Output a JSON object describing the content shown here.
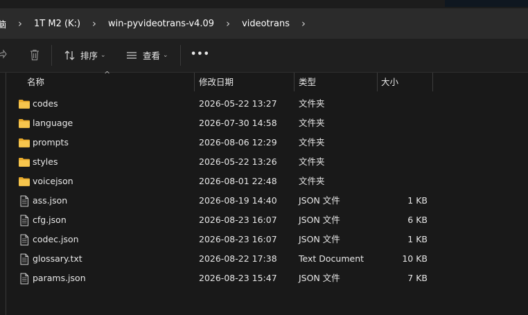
{
  "breadcrumbs": [
    {
      "label": "脑"
    },
    {
      "label": "1T M2 (K:)"
    },
    {
      "label": "win-pyvideotrans-v4.09"
    },
    {
      "label": "videotrans"
    }
  ],
  "toolbar": {
    "sort_label": "排序",
    "view_label": "查看",
    "more_label": "•••"
  },
  "columns": {
    "name": "名称",
    "date": "修改日期",
    "type": "类型",
    "size": "大小"
  },
  "files": [
    {
      "icon": "folder-icon",
      "name": "codes",
      "date": "2026-05-22 13:27",
      "type": "文件夹",
      "size": ""
    },
    {
      "icon": "folder-icon",
      "name": "language",
      "date": "2026-07-30 14:58",
      "type": "文件夹",
      "size": ""
    },
    {
      "icon": "folder-icon",
      "name": "prompts",
      "date": "2026-08-06 12:29",
      "type": "文件夹",
      "size": ""
    },
    {
      "icon": "folder-icon",
      "name": "styles",
      "date": "2026-05-22 13:26",
      "type": "文件夹",
      "size": ""
    },
    {
      "icon": "folder-icon",
      "name": "voicejson",
      "date": "2026-08-01 22:48",
      "type": "文件夹",
      "size": ""
    },
    {
      "icon": "file-icon",
      "name": "ass.json",
      "date": "2026-08-19 14:40",
      "type": "JSON 文件",
      "size": "1 KB"
    },
    {
      "icon": "file-icon",
      "name": "cfg.json",
      "date": "2026-08-23 16:07",
      "type": "JSON 文件",
      "size": "6 KB"
    },
    {
      "icon": "file-icon",
      "name": "codec.json",
      "date": "2026-08-23 16:07",
      "type": "JSON 文件",
      "size": "1 KB"
    },
    {
      "icon": "file-icon",
      "name": "glossary.txt",
      "date": "2026-08-22 17:38",
      "type": "Text Document",
      "size": "10 KB"
    },
    {
      "icon": "file-icon",
      "name": "params.json",
      "date": "2026-08-23 15:47",
      "type": "JSON 文件",
      "size": "7 KB"
    }
  ],
  "colors": {
    "background": "#191919",
    "addressbar": "#2b2b2b",
    "folder": "#f2c14e",
    "text": "#e8e8e8"
  }
}
